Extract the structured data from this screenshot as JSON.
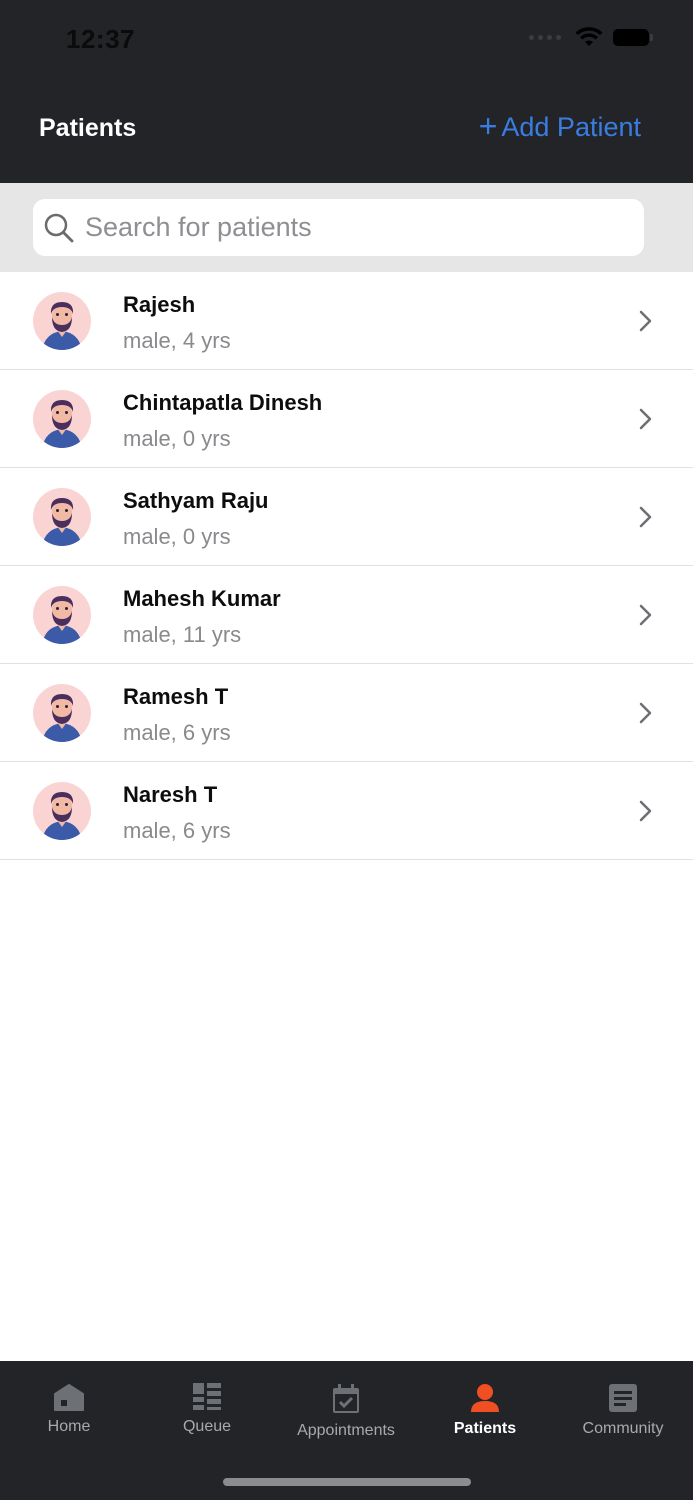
{
  "status_bar": {
    "time": "12:37"
  },
  "header": {
    "title": "Patients",
    "add_label": "Add Patient",
    "add_icon": "plus"
  },
  "search": {
    "placeholder": "Search for patients",
    "value": ""
  },
  "patients": [
    {
      "name": "Rajesh",
      "meta": "male, 4 yrs"
    },
    {
      "name": "Chintapatla Dinesh",
      "meta": "male, 0 yrs"
    },
    {
      "name": "Sathyam Raju",
      "meta": "male, 0 yrs"
    },
    {
      "name": "Mahesh Kumar",
      "meta": "male, 11 yrs"
    },
    {
      "name": "Ramesh T",
      "meta": "male, 6 yrs"
    },
    {
      "name": "Naresh T",
      "meta": "male, 6 yrs"
    }
  ],
  "tabs": [
    {
      "label": "Home",
      "icon": "home-icon"
    },
    {
      "label": "Queue",
      "icon": "queue-icon"
    },
    {
      "label": "Appointments",
      "icon": "calendar-check-icon"
    },
    {
      "label": "Patients",
      "icon": "person-icon",
      "active": true
    },
    {
      "label": "Community",
      "icon": "document-icon"
    }
  ],
  "colors": {
    "header_bg": "#222427",
    "accent": "#3a7de1",
    "active_tab": "#f04e23",
    "avatar_bg": "#f9d4d2"
  }
}
